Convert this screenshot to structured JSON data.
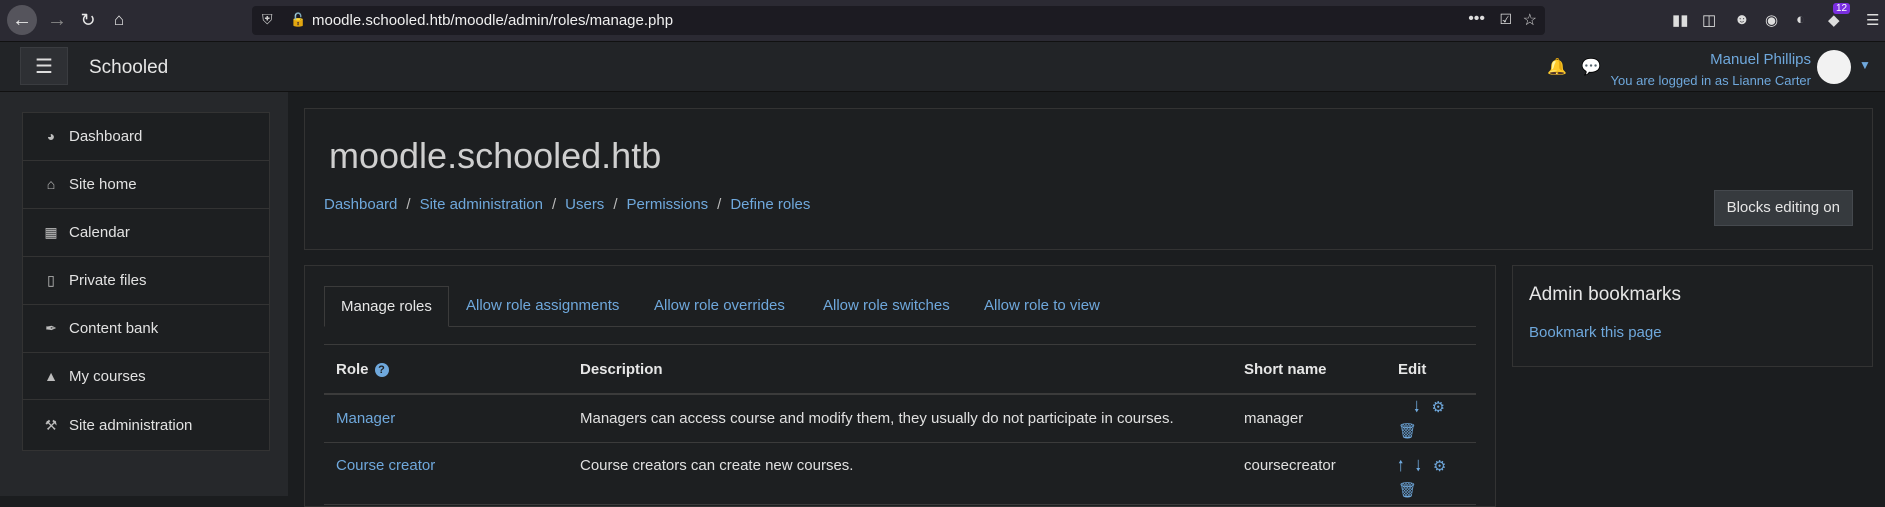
{
  "browser": {
    "url": "moodle.schooled.htb/moodle/admin/roles/manage.php",
    "badge_count": "12"
  },
  "topnav": {
    "site_name": "Schooled",
    "user_name": "Manuel Phillips",
    "logged_in_as": "You are logged in as Lianne Carter"
  },
  "sidebar": {
    "items": [
      {
        "label": "Dashboard",
        "icon": "dashboard-icon"
      },
      {
        "label": "Site home",
        "icon": "home-icon"
      },
      {
        "label": "Calendar",
        "icon": "calendar-icon"
      },
      {
        "label": "Private files",
        "icon": "file-icon"
      },
      {
        "label": "Content bank",
        "icon": "brush-icon"
      },
      {
        "label": "My courses",
        "icon": "graduation-cap-icon"
      }
    ],
    "admin_item": {
      "label": "Site administration",
      "icon": "wrench-icon"
    }
  },
  "header": {
    "title": "moodle.schooled.htb",
    "breadcrumb": [
      "Dashboard",
      "Site administration",
      "Users",
      "Permissions",
      "Define roles"
    ],
    "blocks_editing_label": "Blocks editing on"
  },
  "tabs": [
    "Manage roles",
    "Allow role assignments",
    "Allow role overrides",
    "Allow role switches",
    "Allow role to view"
  ],
  "table": {
    "headers": [
      "Role",
      "Description",
      "Short name",
      "Edit"
    ],
    "rows": [
      {
        "role": "Manager",
        "description": "Managers can access course and modify them, they usually do not participate in courses.",
        "short_name": "manager"
      },
      {
        "role": "Course creator",
        "description": "Course creators can create new courses.",
        "short_name": "coursecreator"
      }
    ]
  },
  "side_block": {
    "title": "Admin bookmarks",
    "link": "Bookmark this page"
  },
  "colors": {
    "accent": "#6fa8dc",
    "background": "#1b1d1f",
    "card": "#1d1f21"
  }
}
